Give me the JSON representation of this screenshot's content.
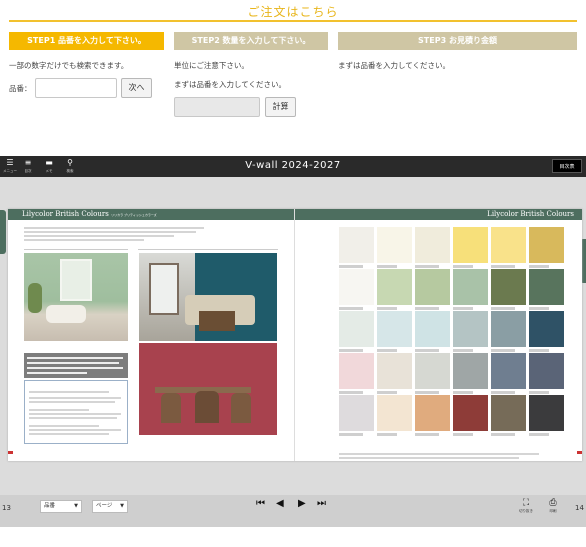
{
  "order": {
    "title": "ご注文はこちら",
    "step1": {
      "label": "STEP1 品番を入力して下さい。",
      "note": "一部の数字だけでも検索できます。",
      "field_label": "品番：",
      "field_value": "",
      "next_button": "次へ"
    },
    "step2": {
      "label": "STEP2 数量を入力して下さい。",
      "note": "単位にご注意下さい。",
      "prompt": "まずは品番を入力してください。",
      "field_value": "",
      "calc_button": "計算"
    },
    "step3": {
      "label": "STEP3 お見積り金額",
      "prompt": "まずは品番を入力してください。"
    }
  },
  "viewer": {
    "title": "V-wall 2024-2027",
    "toc_button": "目次表",
    "toolbar": [
      {
        "icon": "menu-icon",
        "glyph": "☰",
        "label": "メニュー"
      },
      {
        "icon": "list-icon",
        "glyph": "≡",
        "label": "目次"
      },
      {
        "icon": "memo-icon",
        "glyph": "▬",
        "label": "メモ"
      },
      {
        "icon": "search-icon",
        "glyph": "⚲",
        "label": "検索"
      }
    ],
    "book": {
      "left_brand": "Lilycolor  British Colours",
      "left_brand_sub": "リリカラ ブリティッシュカラーズ",
      "right_brand": "Lilycolor  British Colours",
      "swatch_colors": [
        [
          "#f1efe9",
          "#f8f5e8",
          "#f0ecdc",
          "#f7e07a",
          "#f9e28a",
          "#d8b95c"
        ],
        [
          "#f7f6f2",
          "#c7d8b2",
          "#b6c9a0",
          "#a9c2a8",
          "#6b7a4f",
          "#58745d"
        ],
        [
          "#e4ebe6",
          "#d6e6e8",
          "#cfe3e5",
          "#b4c4c4",
          "#8a9ea4",
          "#2f5266"
        ],
        [
          "#f1d8da",
          "#e8e2d8",
          "#d6d8d2",
          "#9fa6a6",
          "#6f7e90",
          "#5a6477"
        ],
        [
          "#dedbdd",
          "#f3e5d2",
          "#e0ab7e",
          "#8e3c38",
          "#766b58",
          "#3b3b3d"
        ]
      ]
    },
    "bottom": {
      "page_left": "13",
      "page_right": "14",
      "select_product": "品番",
      "select_page": "ページ",
      "crop_label": "切り抜き",
      "print_label": "印刷"
    }
  },
  "colors": {
    "accent_yellow": "#f5b800",
    "step_inactive": "#cfc6a4",
    "band_green": "#4d6e5f",
    "viewer_bar": "#2a2a2a"
  }
}
